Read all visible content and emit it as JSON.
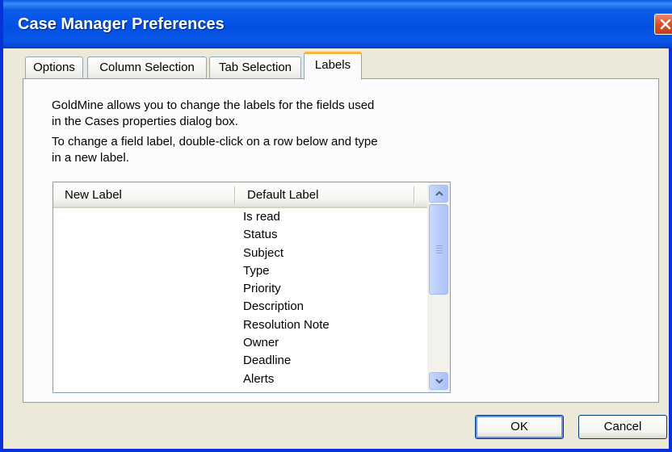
{
  "window": {
    "title": "Case Manager Preferences"
  },
  "tabs": [
    {
      "label": "Options",
      "active": false
    },
    {
      "label": "Column Selection",
      "active": false
    },
    {
      "label": "Tab Selection",
      "active": false
    },
    {
      "label": "Labels",
      "active": true
    }
  ],
  "description": {
    "line1": "GoldMine allows you to change the labels for the fields used",
    "line2": "in the Cases properties dialog box.",
    "line3": "To change a field label, double-click on a row below and type",
    "line4": "in a new label."
  },
  "list": {
    "columns": [
      "New Label",
      "Default Label"
    ],
    "rows": [
      {
        "new_label": "",
        "default_label": "Is read"
      },
      {
        "new_label": "",
        "default_label": "Status"
      },
      {
        "new_label": "",
        "default_label": "Subject"
      },
      {
        "new_label": "",
        "default_label": "Type"
      },
      {
        "new_label": "",
        "default_label": "Priority"
      },
      {
        "new_label": "",
        "default_label": "Description"
      },
      {
        "new_label": "",
        "default_label": "Resolution Note"
      },
      {
        "new_label": "",
        "default_label": "Owner"
      },
      {
        "new_label": "",
        "default_label": "Deadline"
      },
      {
        "new_label": "",
        "default_label": "Alerts"
      }
    ]
  },
  "buttons": {
    "ok": "OK",
    "cancel": "Cancel"
  },
  "colors": {
    "titlebar": "#0250e3",
    "active_tab_accent": "#f7b43a",
    "close_button": "#d8542e"
  },
  "icons": {
    "close": "close-icon",
    "scroll_up": "chevron-up-icon",
    "scroll_down": "chevron-down-icon"
  }
}
